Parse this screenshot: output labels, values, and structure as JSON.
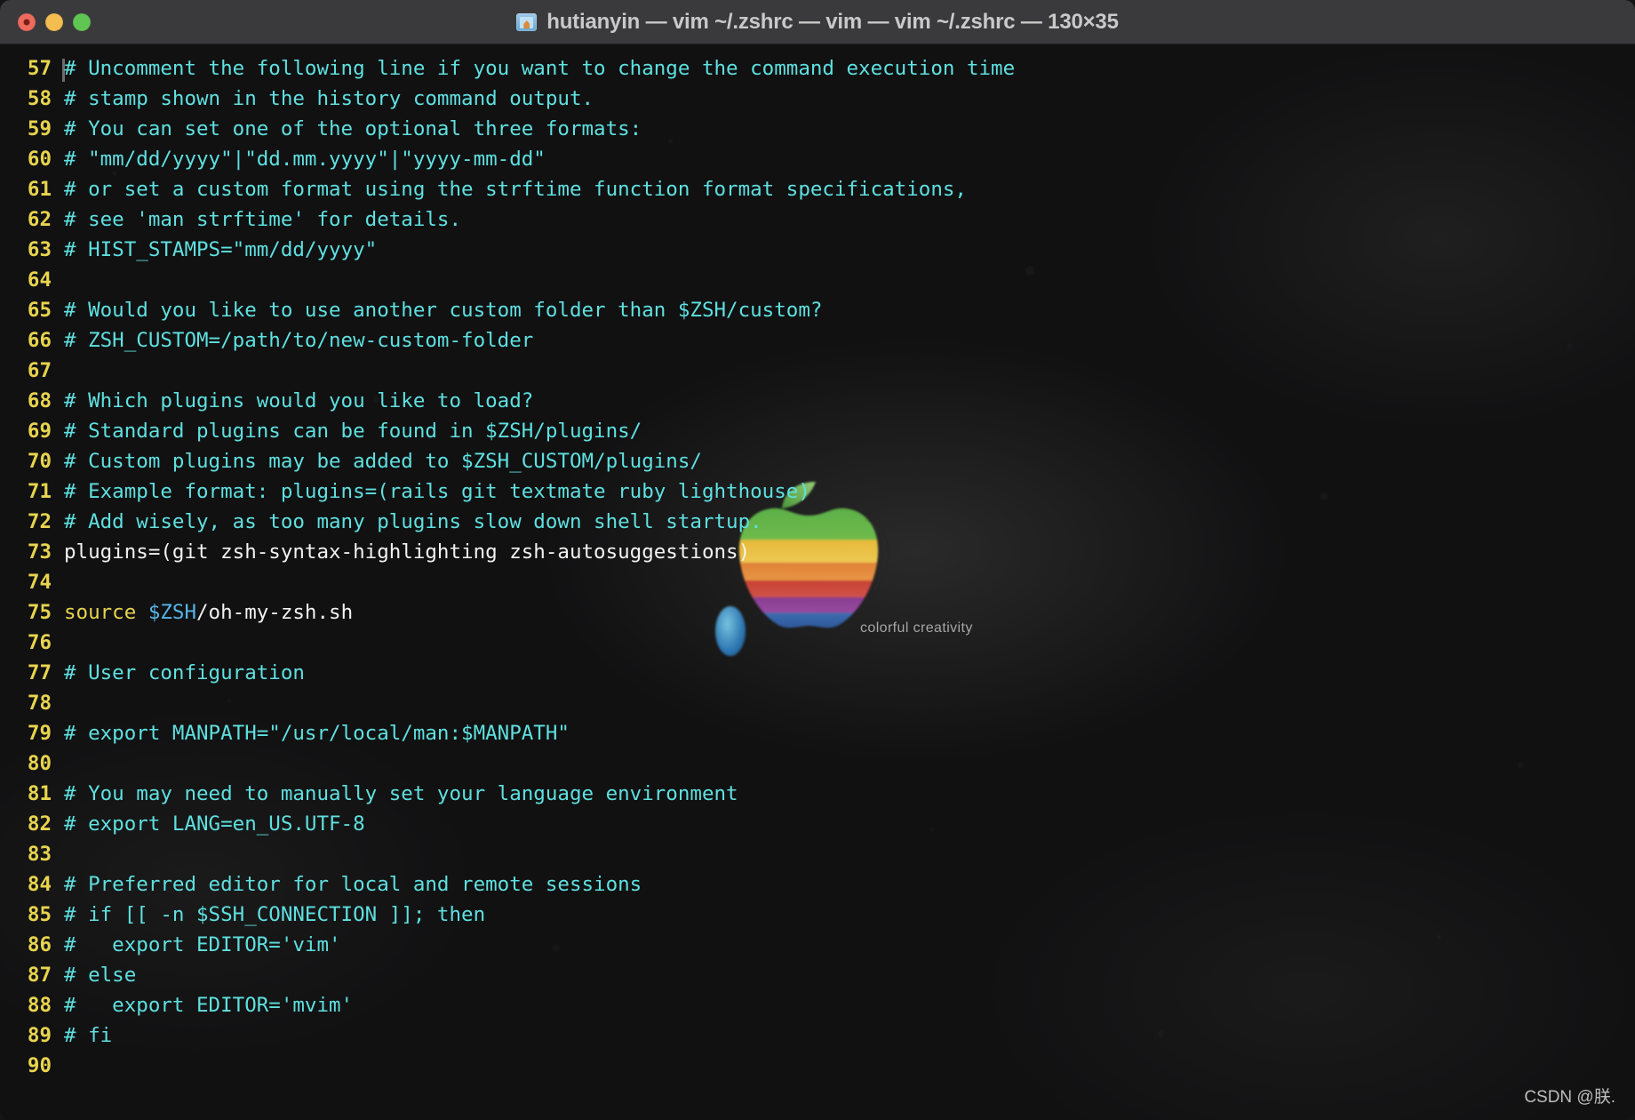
{
  "window": {
    "title": "hutianyin — vim ~/.zshrc — vim — vim ~/.zshrc — 130×35",
    "folder_icon": "folder-icon",
    "controls": {
      "close": "close",
      "minimize": "minimize",
      "maximize": "maximize"
    },
    "colors": {
      "titlebar_bg": "#3a3a3c",
      "close": "#ed6a5e",
      "minimize": "#f4bd4f",
      "maximize": "#61c554",
      "terminal_bg": "#111112",
      "line_number": "#e8d44d",
      "comment": "#5fe0e0",
      "plain_text": "#f2f2f2",
      "keyword": "#e8d44d",
      "variable": "#57b6e8"
    }
  },
  "wallpaper": {
    "tagline": "colorful creativity",
    "logo": "retro-rainbow-apple-logo"
  },
  "watermark": "CSDN @朕.",
  "editor": {
    "app": "vim",
    "file": "~/.zshrc",
    "dimensions": "130×35",
    "first_visible_line": 57,
    "last_visible_line": 90,
    "lines": [
      {
        "n": "57",
        "segments": [
          {
            "t": "# Uncomment the following line if you want to change the command execution time",
            "c": "comment"
          }
        ]
      },
      {
        "n": "58",
        "segments": [
          {
            "t": "# stamp shown in the history command output.",
            "c": "comment"
          }
        ]
      },
      {
        "n": "59",
        "segments": [
          {
            "t": "# You can set one of the optional three formats:",
            "c": "comment"
          }
        ]
      },
      {
        "n": "60",
        "segments": [
          {
            "t": "# \"mm/dd/yyyy\"|\"dd.mm.yyyy\"|\"yyyy-mm-dd\"",
            "c": "comment"
          }
        ]
      },
      {
        "n": "61",
        "segments": [
          {
            "t": "# or set a custom format using the strftime function format specifications,",
            "c": "comment"
          }
        ]
      },
      {
        "n": "62",
        "segments": [
          {
            "t": "# see 'man strftime' for details.",
            "c": "comment"
          }
        ]
      },
      {
        "n": "63",
        "segments": [
          {
            "t": "# HIST_STAMPS=\"mm/dd/yyyy\"",
            "c": "comment"
          }
        ]
      },
      {
        "n": "64",
        "segments": [
          {
            "t": "",
            "c": "plain"
          }
        ]
      },
      {
        "n": "65",
        "segments": [
          {
            "t": "# Would you like to use another custom folder than $ZSH/custom?",
            "c": "comment"
          }
        ]
      },
      {
        "n": "66",
        "segments": [
          {
            "t": "# ZSH_CUSTOM=/path/to/new-custom-folder",
            "c": "comment"
          }
        ]
      },
      {
        "n": "67",
        "segments": [
          {
            "t": "",
            "c": "plain"
          }
        ]
      },
      {
        "n": "68",
        "segments": [
          {
            "t": "# Which plugins would you like to load?",
            "c": "comment"
          }
        ]
      },
      {
        "n": "69",
        "segments": [
          {
            "t": "# Standard plugins can be found in $ZSH/plugins/",
            "c": "comment"
          }
        ]
      },
      {
        "n": "70",
        "segments": [
          {
            "t": "# Custom plugins may be added to $ZSH_CUSTOM/plugins/",
            "c": "comment"
          }
        ]
      },
      {
        "n": "71",
        "segments": [
          {
            "t": "# Example format: plugins=(rails git textmate ruby lighthouse)",
            "c": "comment"
          }
        ]
      },
      {
        "n": "72",
        "segments": [
          {
            "t": "# Add wisely, as too many plugins slow down shell startup.",
            "c": "comment"
          }
        ]
      },
      {
        "n": "73",
        "segments": [
          {
            "t": "plugins=(git zsh-syntax-highlighting zsh-autosuggestions)",
            "c": "plain"
          }
        ]
      },
      {
        "n": "74",
        "segments": [
          {
            "t": "",
            "c": "plain"
          }
        ]
      },
      {
        "n": "75",
        "segments": [
          {
            "t": "source ",
            "c": "keyword"
          },
          {
            "t": "$ZSH",
            "c": "var"
          },
          {
            "t": "/oh-my-zsh.sh",
            "c": "plain"
          }
        ]
      },
      {
        "n": "76",
        "segments": [
          {
            "t": "",
            "c": "plain"
          }
        ]
      },
      {
        "n": "77",
        "segments": [
          {
            "t": "# User configuration",
            "c": "comment"
          }
        ]
      },
      {
        "n": "78",
        "segments": [
          {
            "t": "",
            "c": "plain"
          }
        ]
      },
      {
        "n": "79",
        "segments": [
          {
            "t": "# export MANPATH=\"/usr/local/man:$MANPATH\"",
            "c": "comment"
          }
        ]
      },
      {
        "n": "80",
        "segments": [
          {
            "t": "",
            "c": "plain"
          }
        ]
      },
      {
        "n": "81",
        "segments": [
          {
            "t": "# You may need to manually set your language environment",
            "c": "comment"
          }
        ]
      },
      {
        "n": "82",
        "segments": [
          {
            "t": "# export LANG=en_US.UTF-8",
            "c": "comment"
          }
        ]
      },
      {
        "n": "83",
        "segments": [
          {
            "t": "",
            "c": "plain"
          }
        ]
      },
      {
        "n": "84",
        "segments": [
          {
            "t": "# Preferred editor for local and remote sessions",
            "c": "comment"
          }
        ]
      },
      {
        "n": "85",
        "segments": [
          {
            "t": "# if [[ -n $SSH_CONNECTION ]]; then",
            "c": "comment"
          }
        ]
      },
      {
        "n": "86",
        "segments": [
          {
            "t": "#   export EDITOR='vim'",
            "c": "comment"
          }
        ]
      },
      {
        "n": "87",
        "segments": [
          {
            "t": "# else",
            "c": "comment"
          }
        ]
      },
      {
        "n": "88",
        "segments": [
          {
            "t": "#   export EDITOR='mvim'",
            "c": "comment"
          }
        ]
      },
      {
        "n": "89",
        "segments": [
          {
            "t": "# fi",
            "c": "comment"
          }
        ]
      },
      {
        "n": "90",
        "segments": [
          {
            "t": "",
            "c": "plain"
          }
        ]
      }
    ]
  }
}
